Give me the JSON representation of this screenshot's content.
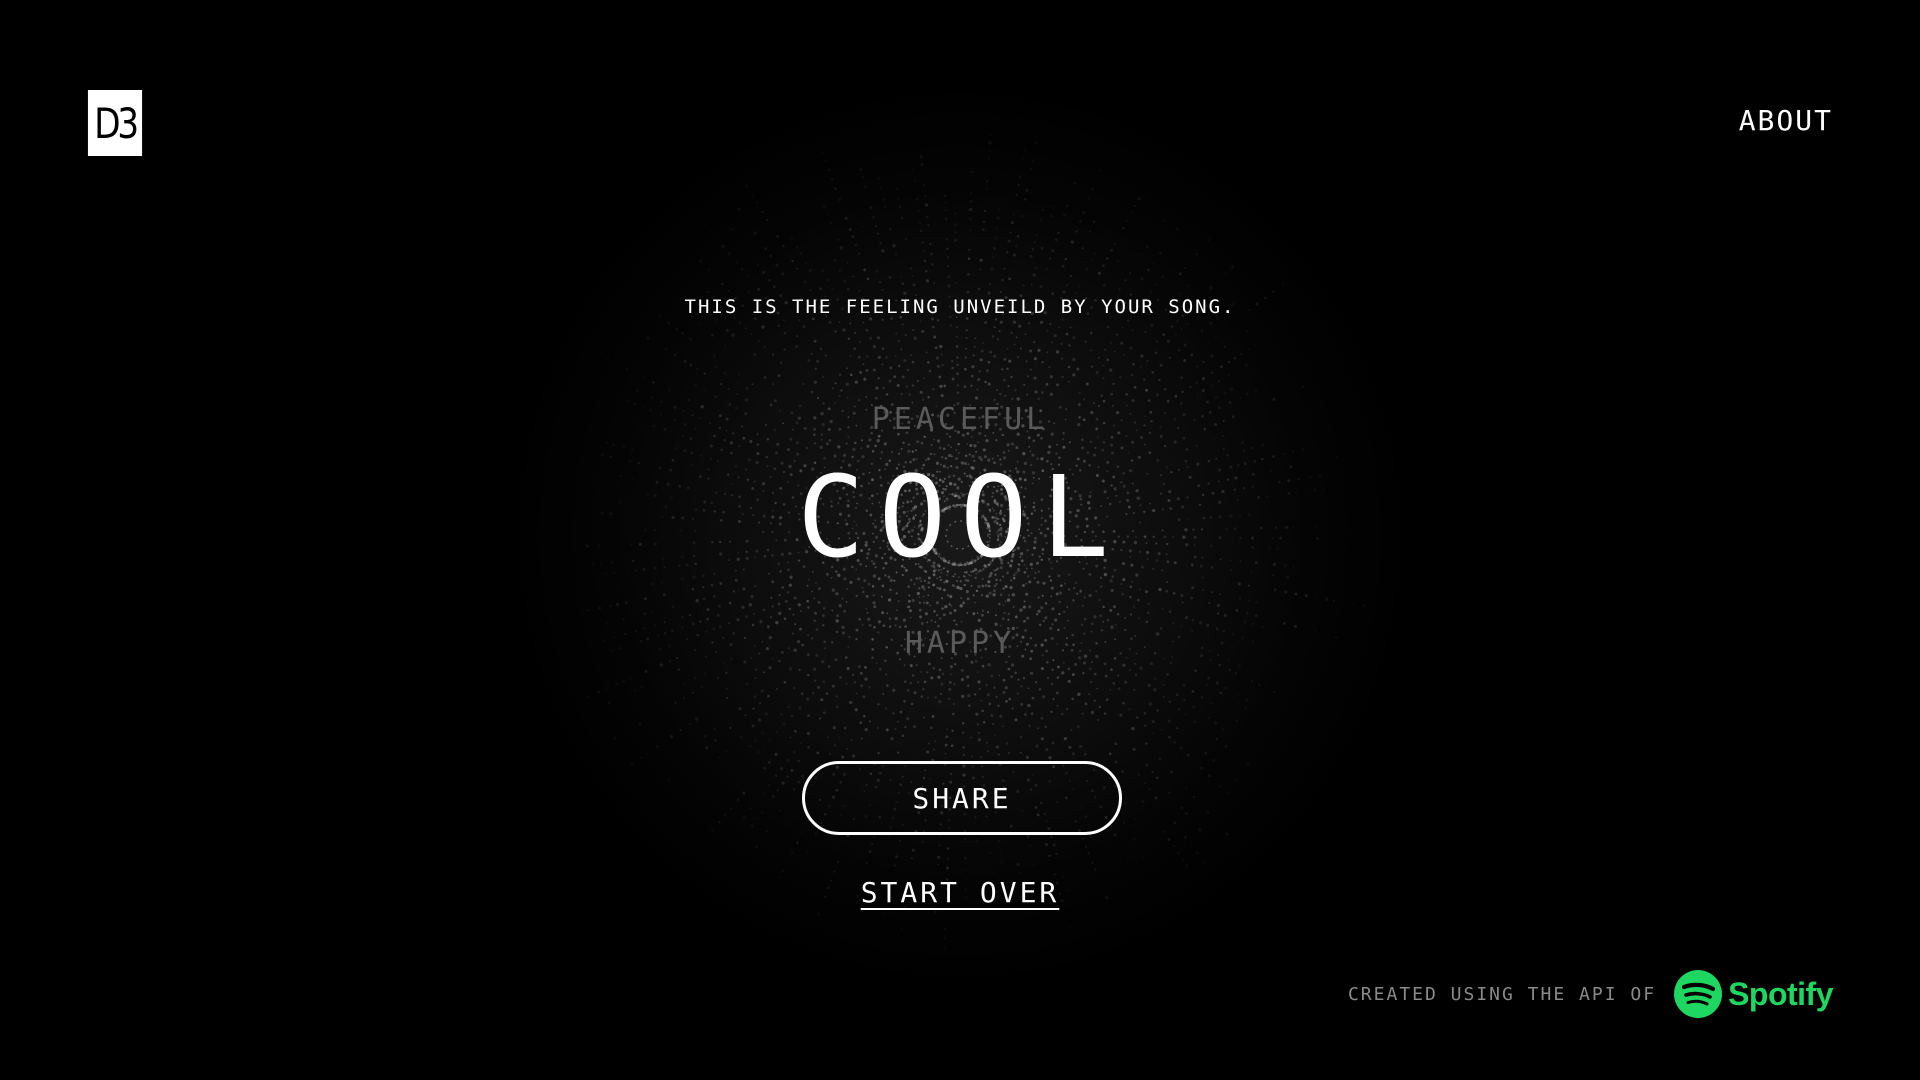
{
  "header": {
    "logo_text": "D3",
    "about_label": "ABOUT"
  },
  "result": {
    "subtitle": "THIS IS THE FEELING UNVEILD BY YOUR SONG.",
    "mood_above": "PEACEFUL",
    "mood_main": "COOL",
    "mood_below": "HAPPY"
  },
  "actions": {
    "share_label": "SHARE",
    "start_over_label": "START OVER"
  },
  "footer": {
    "credit_text": "CREATED USING THE API OF",
    "spotify_wordmark": "Spotify",
    "spotify_icon": "spotify-logo-icon"
  },
  "colors": {
    "background": "#000000",
    "text": "#ffffff",
    "muted_mood": "#5a5a5a",
    "footer_text": "#8a8a8a",
    "spotify_green": "#1ed760"
  }
}
